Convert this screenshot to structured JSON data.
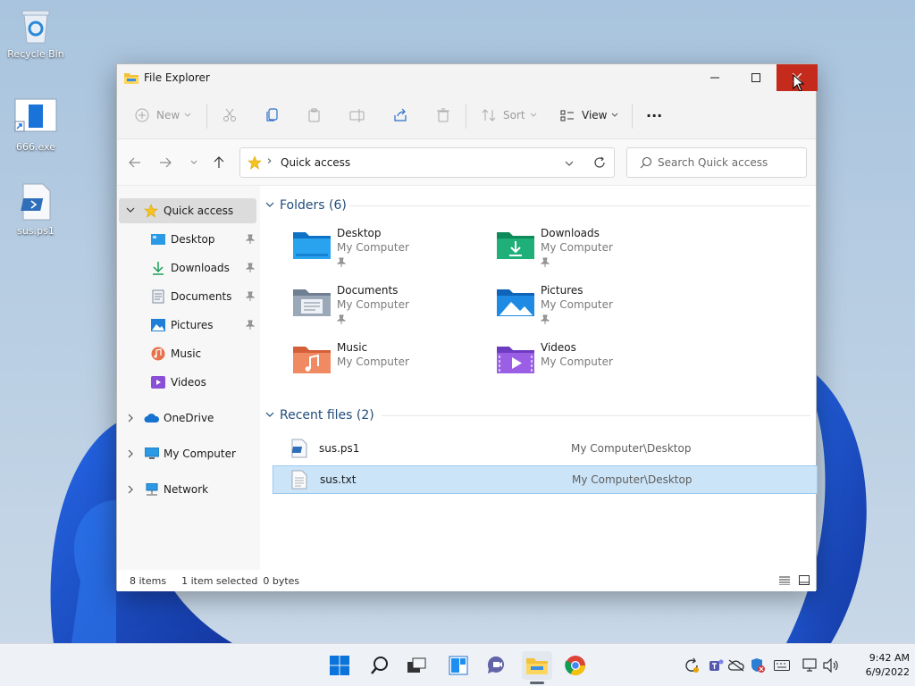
{
  "desktop": {
    "icons": [
      {
        "label": "Recycle Bin"
      },
      {
        "label": "666.exe"
      },
      {
        "label": "sus.ps1"
      }
    ]
  },
  "window": {
    "title": "File Explorer",
    "toolbar": {
      "new_label": "New",
      "sort_label": "Sort",
      "view_label": "View",
      "more_label": "···"
    },
    "nav": {
      "address_path": "Quick access",
      "address_separator": "›",
      "search_placeholder": "Search Quick access"
    },
    "sidebar": {
      "quick_access": "Quick access",
      "items": [
        {
          "label": "Desktop"
        },
        {
          "label": "Downloads"
        },
        {
          "label": "Documents"
        },
        {
          "label": "Pictures"
        },
        {
          "label": "Music"
        },
        {
          "label": "Videos"
        }
      ],
      "onedrive": "OneDrive",
      "my_computer": "My Computer",
      "network": "Network"
    },
    "folders": {
      "heading": "Folders (6)",
      "items": [
        {
          "name": "Desktop",
          "location": "My Computer"
        },
        {
          "name": "Downloads",
          "location": "My Computer"
        },
        {
          "name": "Documents",
          "location": "My Computer"
        },
        {
          "name": "Pictures",
          "location": "My Computer"
        },
        {
          "name": "Music",
          "location": "My Computer"
        },
        {
          "name": "Videos",
          "location": "My Computer"
        }
      ]
    },
    "recent": {
      "heading": "Recent files (2)",
      "files": [
        {
          "name": "sus.ps1",
          "path": "My Computer\\Desktop"
        },
        {
          "name": "sus.txt",
          "path": "My Computer\\Desktop"
        }
      ]
    },
    "status": {
      "count": "8 items",
      "selection": "1 item selected",
      "size": "0 bytes"
    }
  },
  "taskbar": {
    "time": "9:42 AM",
    "date": "6/9/2022"
  },
  "colors": {
    "accent": "#0067c0",
    "close_red": "#c42b1c",
    "selection": "#cce4f7",
    "group_heading": "#234d7a"
  }
}
